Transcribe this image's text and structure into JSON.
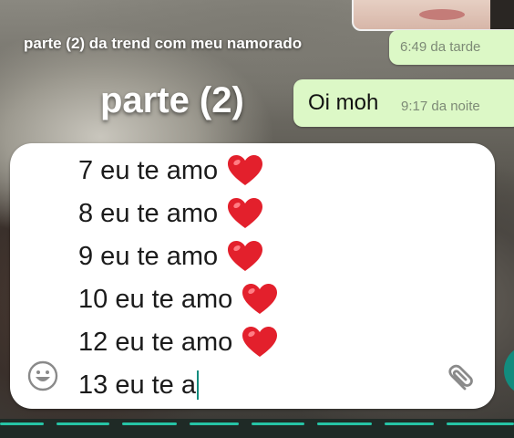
{
  "overlay": {
    "small_caption": "parte (2) da trend com meu namorado",
    "big_caption": "parte (2)"
  },
  "chat": {
    "messages": [
      {
        "text": "",
        "time": "6:49 da tarde"
      },
      {
        "text": "Oi moh",
        "time": "9:17 da noite"
      }
    ]
  },
  "composer": {
    "lines": [
      {
        "text": "7 eu te amo",
        "emoji": "red-heart"
      },
      {
        "text": "8 eu te amo",
        "emoji": "red-heart"
      },
      {
        "text": "9 eu te amo",
        "emoji": "red-heart"
      },
      {
        "text": "10 eu te amo",
        "emoji": "red-heart"
      },
      {
        "text": "12 eu te amo",
        "emoji": "red-heart"
      }
    ],
    "current_text": "13 eu te a",
    "emoji_button_icon": "smiley-icon",
    "attach_button_icon": "paperclip-icon"
  },
  "colors": {
    "outgoing_bubble": "#dcf8c6",
    "heart": "#e3202c",
    "accent": "#128c7e"
  }
}
